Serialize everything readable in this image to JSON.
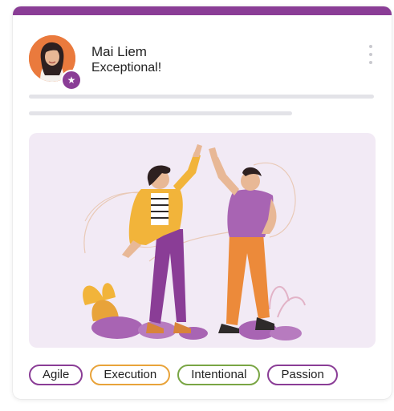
{
  "post": {
    "author": "Mai Liem",
    "message": "Exceptional!"
  },
  "icons": {
    "badge": "star-icon",
    "menu": "more-vertical-icon"
  },
  "colors": {
    "accent": "#8a3d96",
    "illustration_bg": "#f2eaf5",
    "skeleton": "#e3e3e8"
  },
  "tags": [
    {
      "label": "Agile",
      "color": "#8a3d96"
    },
    {
      "label": "Execution",
      "color": "#e8a33a"
    },
    {
      "label": "Intentional",
      "color": "#79a544"
    },
    {
      "label": "Passion",
      "color": "#8a3d96"
    }
  ]
}
